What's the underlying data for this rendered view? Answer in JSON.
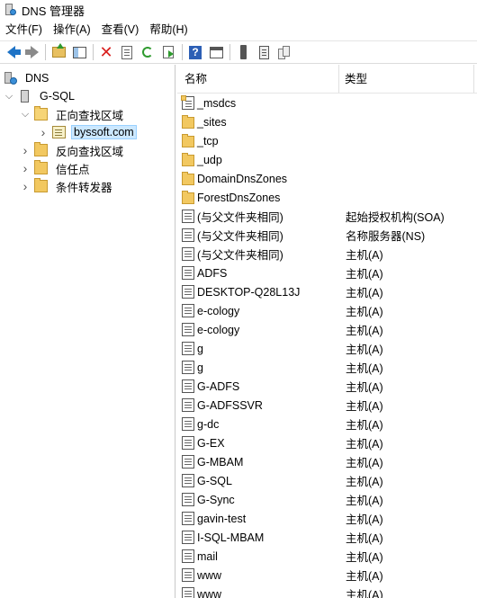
{
  "window": {
    "title": "DNS 管理器"
  },
  "menu": [
    "文件(F)",
    "操作(A)",
    "查看(V)",
    "帮助(H)"
  ],
  "toolbar": [
    "back-icon",
    "forward-icon",
    "up-folder-icon",
    "show-hide-pane-icon",
    "delete-icon",
    "properties-icon",
    "refresh-icon",
    "export-list-icon",
    "help-icon",
    "action-pane-icon",
    "server-icon",
    "server-record-icon",
    "servers-icon"
  ],
  "tree": {
    "root": "DNS",
    "server": "G-SQL",
    "forward_zones": "正向查找区域",
    "zone": "byssoft.com",
    "reverse_zones": "反向查找区域",
    "trust_points": "信任点",
    "conditional_forwarders": "条件转发器"
  },
  "list": {
    "columns": {
      "name": "名称",
      "type": "类型"
    },
    "rows": [
      {
        "name": "_msdcs",
        "type": "",
        "icon": "msdcs"
      },
      {
        "name": "_sites",
        "type": "",
        "icon": "folder"
      },
      {
        "name": "_tcp",
        "type": "",
        "icon": "folder"
      },
      {
        "name": "_udp",
        "type": "",
        "icon": "folder"
      },
      {
        "name": "DomainDnsZones",
        "type": "",
        "icon": "folder"
      },
      {
        "name": "ForestDnsZones",
        "type": "",
        "icon": "folder"
      },
      {
        "name": "(与父文件夹相同)",
        "type": "起始授权机构(SOA)",
        "icon": "record"
      },
      {
        "name": "(与父文件夹相同)",
        "type": "名称服务器(NS)",
        "icon": "record"
      },
      {
        "name": "(与父文件夹相同)",
        "type": "主机(A)",
        "icon": "record"
      },
      {
        "name": "ADFS",
        "type": "主机(A)",
        "icon": "record"
      },
      {
        "name": "DESKTOP-Q28L13J",
        "type": "主机(A)",
        "icon": "record"
      },
      {
        "name": "e-cology",
        "type": "主机(A)",
        "icon": "record"
      },
      {
        "name": "e-cology",
        "type": "主机(A)",
        "icon": "record"
      },
      {
        "name": "g",
        "type": "主机(A)",
        "icon": "record"
      },
      {
        "name": "g",
        "type": "主机(A)",
        "icon": "record"
      },
      {
        "name": "G-ADFS",
        "type": "主机(A)",
        "icon": "record"
      },
      {
        "name": "G-ADFSSVR",
        "type": "主机(A)",
        "icon": "record"
      },
      {
        "name": "g-dc",
        "type": "主机(A)",
        "icon": "record"
      },
      {
        "name": "G-EX",
        "type": "主机(A)",
        "icon": "record"
      },
      {
        "name": "G-MBAM",
        "type": "主机(A)",
        "icon": "record"
      },
      {
        "name": "G-SQL",
        "type": "主机(A)",
        "icon": "record"
      },
      {
        "name": "G-Sync",
        "type": "主机(A)",
        "icon": "record"
      },
      {
        "name": "gavin-test",
        "type": "主机(A)",
        "icon": "record"
      },
      {
        "name": "I-SQL-MBAM",
        "type": "主机(A)",
        "icon": "record"
      },
      {
        "name": "mail",
        "type": "主机(A)",
        "icon": "record"
      },
      {
        "name": "www",
        "type": "主机(A)",
        "icon": "record"
      },
      {
        "name": "www",
        "type": "主机(A)",
        "icon": "record"
      }
    ]
  },
  "colors": {
    "selection": "#cce8ff",
    "selection_border": "#99d1ff",
    "delete": "#d9201e",
    "back_arrow": "#1e73c6"
  }
}
